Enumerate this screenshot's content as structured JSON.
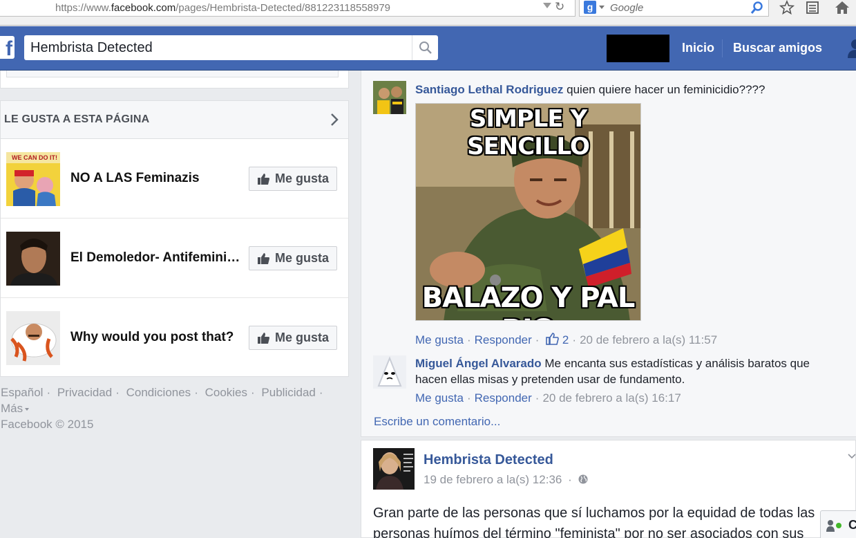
{
  "browser": {
    "url_prefix": "https://www.",
    "url_host": "facebook.com",
    "url_path": "/pages/Hembrista-Detected/881223118558979",
    "search_placeholder": "Google"
  },
  "header": {
    "search_value": "Hembrista Detected",
    "nav_home": "Inicio",
    "nav_find_friends": "Buscar amigos"
  },
  "likes_section": {
    "title": "LE GUSTA A ESTA PÁGINA",
    "like_label": "Me gusta",
    "pages": [
      {
        "name": "NO A LAS Feminazis",
        "thumb_text": "WE CAN DO IT!"
      },
      {
        "name": "El Demoledor- Antifeminista"
      },
      {
        "name": "Why would you post that?"
      }
    ]
  },
  "footer": {
    "links": [
      "Español",
      "Privacidad",
      "Condiciones",
      "Cookies",
      "Publicidad"
    ],
    "more": "Más",
    "copyright": "Facebook © 2015"
  },
  "comments": [
    {
      "author": "Santiago Lethal Rodriguez",
      "text": "quien quiere hacer un feminicidio????",
      "meme_top": "SIMPLE Y SENCILLO",
      "meme_bottom": "BALAZO Y PAL RIO",
      "like": "Me gusta",
      "reply": "Responder",
      "likes_count": "2",
      "time": "20 de febrero a la(s) 11:57"
    },
    {
      "author": "Miguel Ángel Alvarado",
      "text": "Me encanta sus estadísticas y análisis baratos que hacen ellas misas y pretenden usar de fundamento.",
      "like": "Me gusta",
      "reply": "Responder",
      "time": "20 de febrero a la(s) 16:17"
    }
  ],
  "write_comment": "Escribe un comentario...",
  "post": {
    "author": "Hembrista Detected",
    "time": "19 de febrero a la(s) 12:36",
    "text": "Gran parte de las personas que sí luchamos por la equidad de todas las personas huímos del término \"feminista\" por no ser asociados con sus"
  },
  "chat": {
    "label": "C"
  },
  "colors": {
    "brand": "#4267b2",
    "link": "#365899",
    "muted": "#90949c"
  }
}
